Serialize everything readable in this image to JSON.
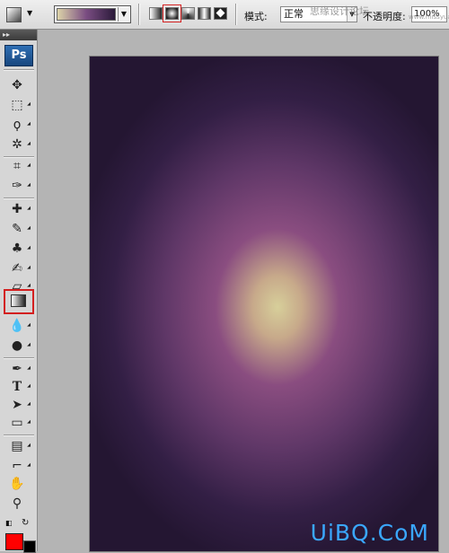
{
  "options_bar": {
    "tool_preset_icon": "gradient-preset-icon",
    "gradient_picker": {
      "colors": [
        "#dcd3a8",
        "#7a4d82",
        "#2b1a3a"
      ]
    },
    "gradient_types": [
      {
        "name": "linear",
        "selected": false
      },
      {
        "name": "radial",
        "selected": true
      },
      {
        "name": "angle",
        "selected": false
      },
      {
        "name": "reflected",
        "selected": false
      },
      {
        "name": "diamond",
        "selected": false
      }
    ],
    "mode_label": "模式:",
    "mode_value": "正常",
    "opacity_label": "不透明度:",
    "opacity_value": "100%",
    "watermark_text": "思缘设计论坛",
    "watermark_url": "www.missyuan.com"
  },
  "toolbox": {
    "logo": "Ps",
    "header": "▸▸",
    "selected_tool": "gradient-tool",
    "foreground_color": "#ff0000",
    "background_color": "#000000"
  },
  "canvas": {
    "watermark": "UiBQ.CoM",
    "gradient_center_color": "#d7cf9a",
    "gradient_edge_color": "#241632"
  }
}
